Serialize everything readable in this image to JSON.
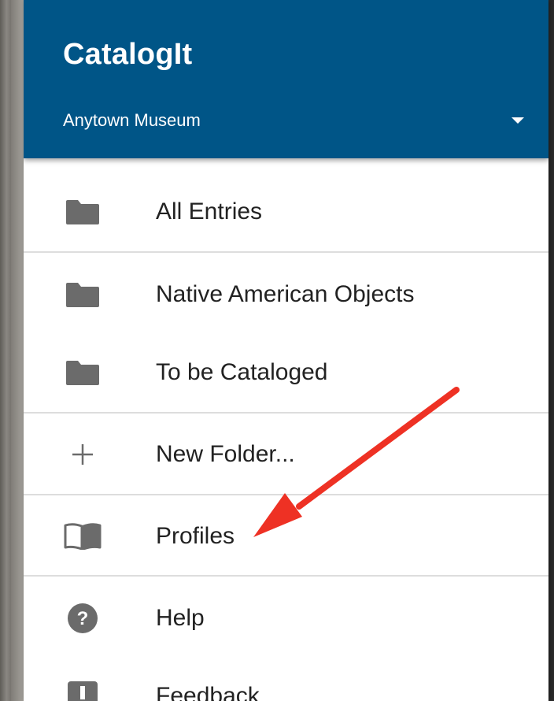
{
  "header": {
    "app_title": "CatalogIt",
    "account": "Anytown Museum"
  },
  "menu": {
    "folders": [
      {
        "label": "All Entries",
        "icon": "folder-icon"
      },
      {
        "label": "Native American Objects",
        "icon": "folder-icon"
      },
      {
        "label": "To be Cataloged",
        "icon": "folder-icon"
      }
    ],
    "new_folder": {
      "label": "New Folder...",
      "icon": "plus-icon"
    },
    "profiles": {
      "label": "Profiles",
      "icon": "book-open-icon"
    },
    "help": {
      "label": "Help",
      "icon": "help-circle-icon"
    },
    "feedback": {
      "label": "Feedback",
      "icon": "feedback-icon"
    }
  },
  "annotation": {
    "icon": "red-arrow-icon",
    "points_to": "Profiles"
  },
  "colors": {
    "header_bg": "#005587",
    "header_text": "#ffffff",
    "icon": "#6b6b6b",
    "text": "#222222",
    "divider": "#dddddd",
    "arrow": "#ee3124"
  }
}
